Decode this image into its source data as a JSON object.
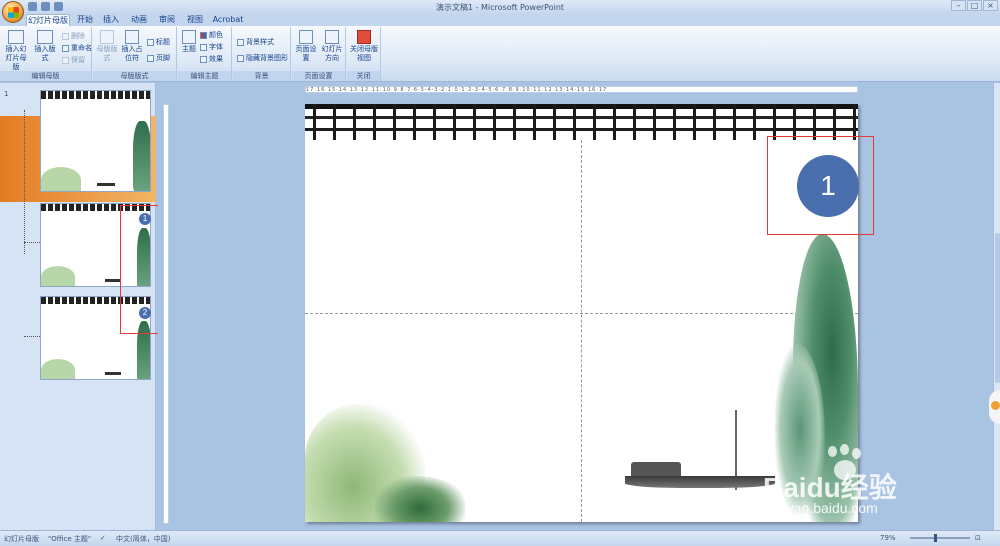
{
  "window": {
    "title": "演示文稿1 - Microsoft PowerPoint",
    "controls": [
      "–",
      "□",
      "×"
    ]
  },
  "tabs": [
    {
      "label": "幻灯片母版",
      "active": true
    },
    {
      "label": "开始",
      "active": false
    },
    {
      "label": "插入",
      "active": false
    },
    {
      "label": "动画",
      "active": false
    },
    {
      "label": "审阅",
      "active": false
    },
    {
      "label": "视图",
      "active": false
    },
    {
      "label": "Acrobat",
      "active": false
    }
  ],
  "ribbon": {
    "groups": {
      "edit_master": "编辑母版",
      "master_layout": "母版版式",
      "edit_theme": "编辑主题",
      "background": "背景",
      "page_setup": "页面设置",
      "close": "关闭"
    },
    "buttons": {
      "insert_master": "插入幻灯片母版",
      "insert_layout": "插入版式",
      "delete": "删除",
      "rename": "重命名",
      "preserve": "保留",
      "master_layout": "母版版式",
      "insert_placeholder": "插入占位符",
      "title": "标题",
      "footer": "页脚",
      "theme": "主题",
      "colors": "颜色",
      "fonts": "字体",
      "effects": "效果",
      "bg_styles": "背景样式",
      "hide_bg": "隐藏背景图形",
      "page_setup": "页面设置",
      "orientation": "幻灯片方向",
      "close_master": "关闭母版视图"
    }
  },
  "thumbnails": [
    {
      "number": "1"
    },
    {
      "number": ""
    },
    {
      "number": ""
    }
  ],
  "ruler": {
    "horizontal": "17·16·15·14·13·12·11·10·9·8·7·6·5·4·3·2·1·0·1·2·3·4·5·6·7·8·9·10·11·12·13·14·15·16·17"
  },
  "annotations": {
    "main_badge": "1",
    "thumb_badge_1": "1",
    "thumb_badge_2": "2"
  },
  "status": {
    "view": "幻灯片母版",
    "theme": "\"Office 主题\"",
    "language": "中文(简体，中国)",
    "zoom": "79%"
  },
  "watermark": {
    "brand": "Baidu经验",
    "url": "jingyan.baidu.com"
  },
  "colors": {
    "ribbon": "#dbe7f5",
    "annotation_red": "#e53935",
    "badge_blue": "#4a6fae",
    "selection_orange": "#e47b23"
  }
}
